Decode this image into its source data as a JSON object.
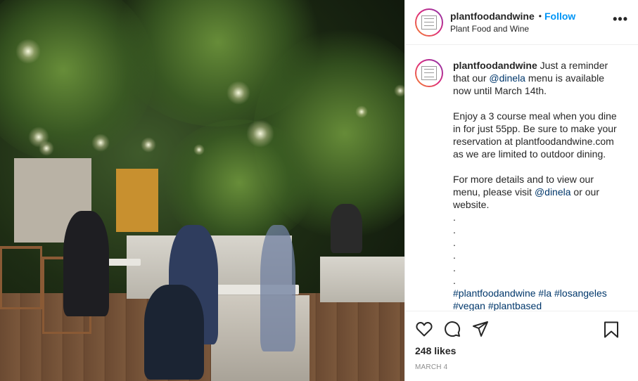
{
  "post": {
    "header": {
      "username": "plantfoodandwine",
      "separator": "•",
      "follow_label": "Follow",
      "subtitle": "Plant Food and Wine",
      "more_label": "•••"
    },
    "caption": {
      "username": "plantfoodandwine",
      "p1_a": "Just a reminder that our ",
      "p1_mention": "@dinela",
      "p1_b": " menu is available now until March 14th.",
      "p2": "Enjoy a 3 course meal when you dine in for just 55pp. Be sure to make your reservation at plantfoodandwine.com as we are limited to outdoor dining.",
      "p3_a": "For more details and to view our menu, please visit ",
      "p3_mention": "@dinela",
      "p3_b": " or our website.",
      "dots": [
        ".",
        ".",
        ".",
        ".",
        ".",
        "."
      ],
      "hashtags_line1": "#plantfoodandwine #la #losangeles",
      "hashtags_line2": "#vegan #plantbased"
    },
    "actions": {
      "icons": [
        "heart-icon",
        "comment-icon",
        "share-icon",
        "bookmark-icon"
      ],
      "likes": "248 likes",
      "date": "MARCH 4"
    },
    "colors": {
      "link": "#0095f6",
      "mention": "#00376b",
      "secondary_text": "#8e8e8e",
      "border": "#efefef"
    }
  }
}
